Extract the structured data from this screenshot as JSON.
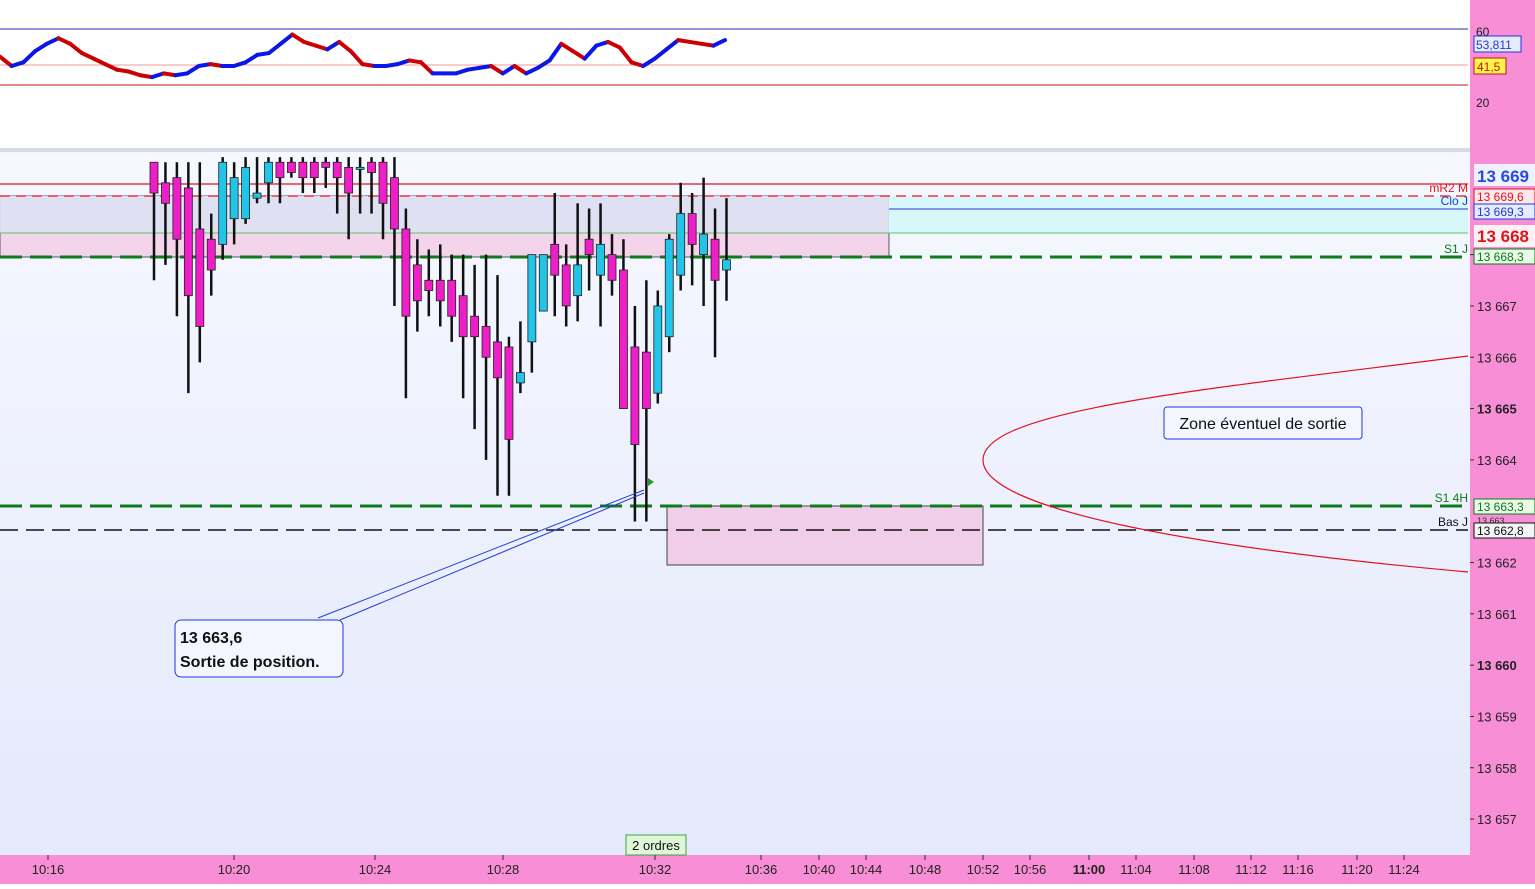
{
  "chart_data": [
    {
      "type": "line",
      "panel": "oscillator",
      "y_ticks": [
        "60",
        "20"
      ],
      "levels": [
        60,
        41.5,
        30
      ],
      "series": [
        {
          "values": [
            45,
            40,
            42,
            48,
            52,
            55,
            52,
            47,
            44,
            41,
            38,
            37,
            35,
            34,
            36,
            35,
            36,
            40,
            41,
            40,
            40,
            42,
            46,
            47,
            52,
            57,
            53,
            51,
            49,
            53,
            48,
            41,
            40,
            40,
            41,
            43,
            42,
            36,
            36,
            36,
            38,
            39,
            40,
            36,
            40,
            36,
            39,
            43,
            52,
            48,
            44,
            51,
            53,
            50,
            42,
            40,
            44,
            49,
            54,
            53,
            52,
            51,
            54
          ]
        }
      ],
      "labels": {
        "current_value": "53,811",
        "level_value": "41,5"
      },
      "colors": {
        "up": "#0a17e6",
        "down": "#cc0000"
      }
    },
    {
      "type": "candlestick",
      "panel": "price",
      "ylim": [
        13656.3,
        13670.0
      ],
      "y_ticks": [
        {
          "v": 13668,
          "label": "13 668",
          "bold": false
        },
        {
          "v": 13667,
          "label": "13 667",
          "bold": false
        },
        {
          "v": 13666,
          "label": "13 666",
          "bold": false
        },
        {
          "v": 13665,
          "label": "13 665",
          "bold": true
        },
        {
          "v": 13664,
          "label": "13 664",
          "bold": false
        },
        {
          "v": 13662,
          "label": "13 662",
          "bold": false
        },
        {
          "v": 13661,
          "label": "13 661",
          "bold": false
        },
        {
          "v": 13660,
          "label": "13 660",
          "bold": true
        },
        {
          "v": 13659,
          "label": "13 659",
          "bold": false
        },
        {
          "v": 13658,
          "label": "13 658",
          "bold": false
        },
        {
          "v": 13657,
          "label": "13 657",
          "bold": false
        }
      ],
      "x_ticks": [
        {
          "label": "10:16",
          "bold": false
        },
        {
          "label": "10:20",
          "bold": false
        },
        {
          "label": "10:24",
          "bold": false
        },
        {
          "label": "10:28",
          "bold": false
        },
        {
          "label": "10:32",
          "bold": false
        },
        {
          "label": "10:36",
          "bold": false
        },
        {
          "label": "10:40",
          "bold": false
        },
        {
          "label": "10:44",
          "bold": false
        },
        {
          "label": "10:48",
          "bold": false
        },
        {
          "label": "10:52",
          "bold": false
        },
        {
          "label": "10:56",
          "bold": false
        },
        {
          "label": "11:00",
          "bold": true
        },
        {
          "label": "11:04",
          "bold": false
        },
        {
          "label": "11:08",
          "bold": false
        },
        {
          "label": "11:12",
          "bold": false
        },
        {
          "label": "11:16",
          "bold": false
        },
        {
          "label": "11:20",
          "bold": false
        },
        {
          "label": "11:24",
          "bold": false
        }
      ],
      "candles": [
        {
          "o": 13669.8,
          "h": 13669.8,
          "l": 13667.5,
          "c": 13669.2
        },
        {
          "o": 13669.4,
          "h": 13669.8,
          "l": 13667.8,
          "c": 13669.0
        },
        {
          "o": 13669.5,
          "h": 13669.8,
          "l": 13666.8,
          "c": 13668.3
        },
        {
          "o": 13669.3,
          "h": 13669.8,
          "l": 13665.3,
          "c": 13667.2
        },
        {
          "o": 13668.5,
          "h": 13669.8,
          "l": 13665.9,
          "c": 13666.6
        },
        {
          "o": 13668.3,
          "h": 13668.8,
          "l": 13667.2,
          "c": 13667.7
        },
        {
          "o": 13668.2,
          "h": 13669.9,
          "l": 13667.9,
          "c": 13669.8
        },
        {
          "o": 13668.7,
          "h": 13669.8,
          "l": 13668.2,
          "c": 13669.5
        },
        {
          "o": 13668.7,
          "h": 13669.9,
          "l": 13668.6,
          "c": 13669.7
        },
        {
          "o": 13669.1,
          "h": 13669.9,
          "l": 13669.0,
          "c": 13669.2
        },
        {
          "o": 13669.4,
          "h": 13669.9,
          "l": 13669.0,
          "c": 13669.8
        },
        {
          "o": 13669.8,
          "h": 13669.9,
          "l": 13669.0,
          "c": 13669.5
        },
        {
          "o": 13669.8,
          "h": 13669.9,
          "l": 13669.5,
          "c": 13669.6
        },
        {
          "o": 13669.8,
          "h": 13669.9,
          "l": 13669.2,
          "c": 13669.5
        },
        {
          "o": 13669.8,
          "h": 13669.9,
          "l": 13669.2,
          "c": 13669.5
        },
        {
          "o": 13669.8,
          "h": 13669.9,
          "l": 13669.3,
          "c": 13669.7
        },
        {
          "o": 13669.8,
          "h": 13669.9,
          "l": 13668.8,
          "c": 13669.5
        },
        {
          "o": 13669.7,
          "h": 13669.9,
          "l": 13668.3,
          "c": 13669.2
        },
        {
          "o": 13669.7,
          "h": 13669.9,
          "l": 13668.8,
          "c": 13669.7
        },
        {
          "o": 13669.8,
          "h": 13669.9,
          "l": 13668.8,
          "c": 13669.6
        },
        {
          "o": 13669.8,
          "h": 13669.9,
          "l": 13668.3,
          "c": 13669.0
        },
        {
          "o": 13669.5,
          "h": 13669.9,
          "l": 13667.0,
          "c": 13668.5
        },
        {
          "o": 13668.5,
          "h": 13668.9,
          "l": 13665.2,
          "c": 13666.8
        },
        {
          "o": 13667.8,
          "h": 13668.3,
          "l": 13666.5,
          "c": 13667.1
        },
        {
          "o": 13667.5,
          "h": 13668.1,
          "l": 13666.8,
          "c": 13667.3
        },
        {
          "o": 13667.5,
          "h": 13668.2,
          "l": 13666.6,
          "c": 13667.1
        },
        {
          "o": 13667.5,
          "h": 13668.0,
          "l": 13666.3,
          "c": 13666.8
        },
        {
          "o": 13667.2,
          "h": 13668.0,
          "l": 13665.2,
          "c": 13666.4
        },
        {
          "o": 13666.8,
          "h": 13667.8,
          "l": 13664.6,
          "c": 13666.4
        },
        {
          "o": 13666.6,
          "h": 13668.0,
          "l": 13664.0,
          "c": 13666.0
        },
        {
          "o": 13666.3,
          "h": 13667.6,
          "l": 13663.3,
          "c": 13665.6
        },
        {
          "o": 13666.2,
          "h": 13666.4,
          "l": 13663.3,
          "c": 13664.4
        },
        {
          "o": 13665.5,
          "h": 13666.7,
          "l": 13665.3,
          "c": 13665.7
        },
        {
          "o": 13666.3,
          "h": 13668.0,
          "l": 13665.7,
          "c": 13668.0
        },
        {
          "o": 13666.9,
          "h": 13668.0,
          "l": 13666.9,
          "c": 13668.0
        },
        {
          "o": 13668.2,
          "h": 13669.2,
          "l": 13666.8,
          "c": 13667.6
        },
        {
          "o": 13667.8,
          "h": 13668.2,
          "l": 13666.6,
          "c": 13667.0
        },
        {
          "o": 13667.2,
          "h": 13669.0,
          "l": 13666.7,
          "c": 13667.8
        },
        {
          "o": 13668.3,
          "h": 13668.9,
          "l": 13667.3,
          "c": 13668.0
        },
        {
          "o": 13667.6,
          "h": 13669.0,
          "l": 13666.6,
          "c": 13668.2
        },
        {
          "o": 13668.0,
          "h": 13668.4,
          "l": 13667.2,
          "c": 13667.5
        },
        {
          "o": 13667.7,
          "h": 13668.3,
          "l": 13665.5,
          "c": 13665.0
        },
        {
          "o": 13666.2,
          "h": 13667.0,
          "l": 13662.8,
          "c": 13664.3
        },
        {
          "o": 13666.1,
          "h": 13667.5,
          "l": 13662.8,
          "c": 13665.0
        },
        {
          "o": 13665.3,
          "h": 13667.3,
          "l": 13665.1,
          "c": 13667.0
        },
        {
          "o": 13666.4,
          "h": 13668.4,
          "l": 13666.1,
          "c": 13668.3
        },
        {
          "o": 13667.6,
          "h": 13669.4,
          "l": 13667.3,
          "c": 13668.8
        },
        {
          "o": 13668.8,
          "h": 13669.2,
          "l": 13667.4,
          "c": 13668.2
        },
        {
          "o": 13668.0,
          "h": 13669.5,
          "l": 13667.0,
          "c": 13668.4
        },
        {
          "o": 13668.3,
          "h": 13668.9,
          "l": 13666.0,
          "c": 13667.5
        },
        {
          "o": 13667.7,
          "h": 13669.1,
          "l": 13667.1,
          "c": 13667.9
        }
      ],
      "horizontal_levels": [
        {
          "name": "mR2 M",
          "value": "13 669,6",
          "color": "#e0141e"
        },
        {
          "name": "Clo J",
          "value": "13 669,3",
          "color": "#1f3ad8"
        },
        {
          "name": "S1 J",
          "value": "13 668,3",
          "color": "#0e7a1c"
        },
        {
          "name": "S1 4H",
          "value": "13 663,3",
          "color": "#0e7a1c"
        },
        {
          "name": "Bas J",
          "value": "13 662,8",
          "color": "#111111"
        }
      ],
      "price_tags": {
        "top_blue": "13 669",
        "current_red": "13 668",
        "overlap": "13 663"
      },
      "annotations": {
        "exit_callout_line1": "13 663,6",
        "exit_callout_line2": "Sortie de position.",
        "zone_label": "Zone éventuel de sortie",
        "orders_label": "2 ordres"
      },
      "colors": {
        "bull": "#22c5e8",
        "bear": "#ee1ec8",
        "background": "#eef2fc",
        "axis": "#f78ed6"
      }
    }
  ]
}
